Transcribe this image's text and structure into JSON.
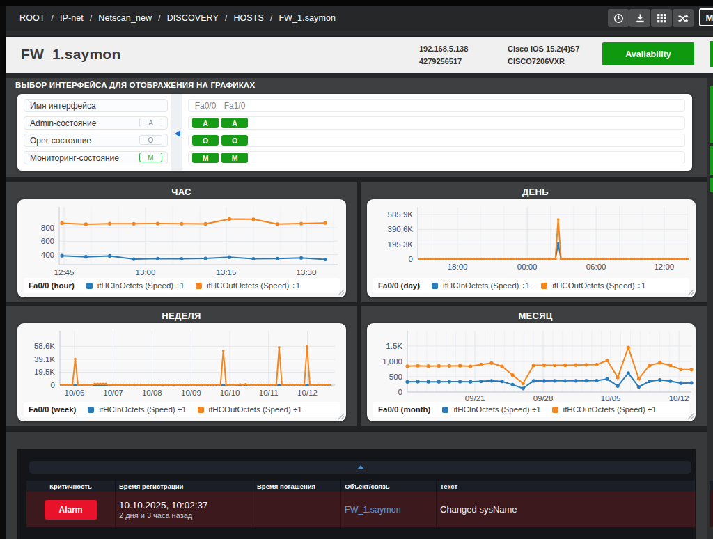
{
  "navbar": {
    "breadcrumb": [
      "ROOT",
      "IP-net",
      "Netscan_new",
      "DISCOVERY",
      "HOSTS",
      "FW_1.saymon"
    ],
    "separator": "/",
    "buttons": [
      {
        "icon": "clock-icon"
      },
      {
        "icon": "download-icon"
      },
      {
        "icon": "grid-icon"
      },
      {
        "icon": "shuffle-icon"
      }
    ],
    "mode_button_label": "M"
  },
  "header": {
    "title": "FW_1.saymon",
    "ip": "192.168.5.138",
    "object_id": "4279256517",
    "os_version": "Cisco IOS 15.2(4)S7",
    "model": "CISCO7206VXR",
    "availability_label": "Availability",
    "availability_color": "#0f990f"
  },
  "interface_panel": {
    "title": "ВЫБОР ИНТЕРФЕЙСА ДЛЯ ОТОБРАЖЕНИЯ НА ГРАФИКАХ",
    "rows": [
      {
        "label": "Имя интерфейса",
        "badge": ""
      },
      {
        "label": "Admin-состояние",
        "badge": "A",
        "badge_style": "gray"
      },
      {
        "label": "Oper-состояние",
        "badge": "O",
        "badge_style": "gray"
      },
      {
        "label": "Мониторинг-состояние",
        "badge": "M",
        "badge_style": "green-outline"
      }
    ],
    "interfaces": [
      "Fa0/0",
      "Fa1/0"
    ],
    "status_rows": [
      [
        "A",
        "A"
      ],
      [
        "O",
        "O"
      ],
      [
        "M",
        "M"
      ]
    ],
    "badge_color": "#169c16"
  },
  "chart_data": [
    {
      "type": "line",
      "title": "ЧАС",
      "legend_label": "Fa0/0 (hour)",
      "x": {
        "fstart": 0.01,
        "fend": 0.955,
        "ticks": [
          {
            "f": 0.0175,
            "label": "12:45"
          },
          {
            "f": 0.31,
            "label": "13:00"
          },
          {
            "f": 0.6,
            "label": "13:15"
          },
          {
            "f": 0.8875,
            "label": "13:30"
          }
        ],
        "minor": [
          0.115,
          0.2125,
          0.4075,
          0.505,
          0.6975,
          0.795,
          0.985
        ]
      },
      "y": {
        "bottom_value": 251,
        "top_value": 1110,
        "ticks": [
          {
            "v": 400,
            "label": "400"
          },
          {
            "v": 600,
            "label": "600"
          },
          {
            "v": 800,
            "label": "800"
          }
        ]
      },
      "series": [
        {
          "name": "ifHCInOctets (Speed) ÷1",
          "color": "#2c7bb9",
          "values": [
            383,
            368,
            381,
            333,
            341,
            339,
            343,
            363,
            339,
            341,
            351,
            329
          ]
        },
        {
          "name": "ifHCOutOctets (Speed) ÷1",
          "color": "#f5861f",
          "values": [
            868,
            852,
            860,
            858,
            861,
            859,
            857,
            930,
            926,
            853,
            861,
            870
          ]
        }
      ],
      "layout": {
        "plot_l": 60,
        "plot_r": 460,
        "plot_b": 94,
        "point_r": 2.6
      }
    },
    {
      "type": "line",
      "title": "ДЕНЬ",
      "legend_label": "Fa0/0 (day)",
      "x": {
        "fstart": 0.008,
        "fend": 1.0,
        "ticks": [
          {
            "f": 0.147,
            "label": "18:00"
          },
          {
            "f": 0.405,
            "label": "00:00"
          },
          {
            "f": 0.66,
            "label": "06:00"
          },
          {
            "f": 0.912,
            "label": "12:00"
          }
        ],
        "minor": [
          0.061,
          0.233,
          0.319,
          0.491,
          0.577,
          0.746,
          0.832,
          0.998
        ]
      },
      "y": {
        "bottom_value": 0,
        "top_value": 687000,
        "ticks": [
          {
            "v": 0,
            "label": "0"
          },
          {
            "v": 195300,
            "label": "195.3K"
          },
          {
            "v": 390600,
            "label": "390.6K"
          },
          {
            "v": 585900,
            "label": "585.9K"
          }
        ]
      },
      "series": [
        {
          "name": "ifHCInOctets (Speed) ÷1",
          "color": "#2c7bb9",
          "values": [
            300,
            300,
            300,
            300,
            300,
            300,
            300,
            300,
            300,
            300,
            300,
            300,
            300,
            300,
            300,
            300,
            300,
            300,
            300,
            300,
            300,
            300,
            300,
            300,
            300,
            300,
            300,
            300,
            300,
            300,
            300,
            300,
            300,
            300,
            300,
            300,
            300,
            300,
            300,
            300,
            300,
            300,
            300,
            300,
            300,
            300,
            300,
            300,
            300,
            210000,
            300,
            300,
            300,
            300,
            300,
            300,
            300,
            300,
            300,
            300,
            300,
            300,
            300,
            300,
            300,
            300,
            300,
            300,
            300,
            300,
            300,
            300,
            300,
            300,
            300,
            300,
            300,
            300,
            300,
            300,
            300,
            300,
            300,
            300,
            300,
            300,
            300,
            300,
            300,
            300,
            300,
            300,
            300,
            300,
            300,
            300
          ]
        },
        {
          "name": "ifHCOutOctets (Speed) ÷1",
          "color": "#f5861f",
          "values": [
            800,
            800,
            800,
            800,
            800,
            800,
            800,
            800,
            800,
            800,
            800,
            800,
            800,
            800,
            800,
            800,
            800,
            800,
            800,
            800,
            800,
            800,
            800,
            800,
            800,
            800,
            800,
            800,
            800,
            800,
            800,
            800,
            800,
            800,
            800,
            800,
            800,
            800,
            800,
            800,
            800,
            800,
            800,
            800,
            800,
            800,
            800,
            800,
            800,
            522000,
            800,
            800,
            800,
            800,
            800,
            800,
            800,
            800,
            800,
            800,
            800,
            800,
            800,
            800,
            800,
            800,
            800,
            800,
            800,
            800,
            800,
            800,
            800,
            800,
            800,
            800,
            800,
            800,
            800,
            800,
            800,
            800,
            800,
            800,
            800,
            800,
            800,
            800,
            800,
            800,
            800,
            800,
            800,
            800,
            800,
            800
          ]
        }
      ],
      "layout": {
        "plot_l": 73,
        "plot_r": 461,
        "plot_b": 86,
        "point_r": 1.8
      }
    },
    {
      "type": "line",
      "title": "НЕДЕЛЯ",
      "legend_label": "Fa0/0 (week)",
      "x": {
        "fstart": 0.005,
        "fend": 0.98,
        "ticks": [
          {
            "f": 0.053,
            "label": "10/06"
          },
          {
            "f": 0.194,
            "label": "10/07"
          },
          {
            "f": 0.335,
            "label": "10/08"
          },
          {
            "f": 0.477,
            "label": "10/09"
          },
          {
            "f": 0.618,
            "label": "10/10"
          },
          {
            "f": 0.759,
            "label": "10/11"
          },
          {
            "f": 0.9,
            "label": "10/12"
          }
        ],
        "minor": []
      },
      "y": {
        "bottom_value": 0,
        "top_value": 82200,
        "ticks": [
          {
            "v": 0,
            "label": "0"
          },
          {
            "v": 19500,
            "label": "19.5K"
          },
          {
            "v": 39100,
            "label": "39.1K"
          },
          {
            "v": 58600,
            "label": "58.6K"
          }
        ]
      },
      "series": [
        {
          "name": "ifHCInOctets (Speed) ÷1",
          "color": "#2c7bb9",
          "values": [
            120,
            120,
            120,
            120,
            120,
            120,
            120,
            120,
            120,
            120,
            120,
            120,
            120,
            120,
            120,
            120,
            120,
            120,
            120,
            120,
            120,
            120,
            120,
            120,
            120,
            120,
            120,
            120,
            120,
            120,
            120,
            120,
            120,
            120,
            120,
            120,
            120,
            120,
            120,
            120,
            120,
            120,
            120,
            120,
            120,
            120,
            120,
            120,
            120,
            120,
            120,
            120,
            120,
            120,
            120,
            120,
            120,
            120,
            120,
            120,
            120,
            120,
            120,
            120,
            120,
            120,
            120,
            120,
            120,
            120,
            120,
            120,
            120,
            120,
            120,
            120,
            120,
            120,
            120,
            120,
            120,
            120,
            120,
            120,
            120,
            120,
            120,
            120,
            120,
            120,
            120,
            120,
            120,
            120,
            120,
            120,
            120
          ]
        },
        {
          "name": "ifHCOutOctets (Speed) ÷1",
          "color": "#f5861f",
          "values": [
            250,
            250,
            250,
            250,
            250,
            39500,
            250,
            250,
            250,
            250,
            250,
            250,
            1700,
            1700,
            1700,
            1700,
            1700,
            250,
            250,
            250,
            250,
            250,
            250,
            250,
            250,
            250,
            250,
            250,
            250,
            250,
            250,
            250,
            250,
            250,
            250,
            250,
            250,
            250,
            250,
            250,
            250,
            250,
            250,
            250,
            250,
            250,
            250,
            250,
            250,
            250,
            250,
            250,
            250,
            250,
            250,
            250,
            250,
            250,
            52000,
            250,
            250,
            250,
            250,
            250,
            1100,
            250,
            1300,
            250,
            250,
            250,
            250,
            250,
            250,
            250,
            250,
            250,
            250,
            250,
            57000,
            250,
            250,
            250,
            250,
            250,
            250,
            250,
            250,
            250,
            58600,
            250,
            250,
            250,
            250,
            250,
            250,
            250,
            250
          ]
        }
      ],
      "layout": {
        "plot_l": 61,
        "plot_r": 456,
        "plot_b": 89,
        "point_r": 1.8
      }
    },
    {
      "type": "line",
      "title": "МЕСЯЦ",
      "legend_label": "Fa0/0 (month)",
      "x": {
        "fstart": 0.0,
        "fend": 1.0,
        "ticks": [
          {
            "f": 0.238,
            "label": "09/21"
          },
          {
            "f": 0.478,
            "label": "09/28"
          },
          {
            "f": 0.716,
            "label": "10/05"
          },
          {
            "f": 0.956,
            "label": "10/12"
          }
        ],
        "minor": [
          0.0341,
          0.0683,
          0.1024,
          0.1366,
          0.1708,
          0.2049,
          0.2732,
          0.3074,
          0.3415,
          0.3756,
          0.4098,
          0.444,
          0.5122,
          0.5464,
          0.5806,
          0.6147,
          0.6489,
          0.683,
          0.7513,
          0.7854,
          0.8196,
          0.8538,
          0.8879,
          0.9221
        ]
      },
      "y": {
        "bottom_value": 0,
        "top_value": 2000,
        "ticks": [
          {
            "v": 0,
            "label": "0"
          },
          {
            "v": 500,
            "label": "500"
          },
          {
            "v": 1000,
            "label": "1,000"
          },
          {
            "v": 1500,
            "label": "1.5K"
          }
        ]
      },
      "series": [
        {
          "name": "ifHCInOctets (Speed) ÷1",
          "color": "#2c7bb9",
          "values": [
            335,
            338,
            336,
            337,
            338,
            340,
            336,
            350,
            368,
            348,
            240,
            118,
            365,
            367,
            368,
            368,
            369,
            370,
            372,
            428,
            198,
            618,
            168,
            352,
            398,
            360,
            292,
            300
          ]
        },
        {
          "name": "ifHCOutOctets (Speed) ÷1",
          "color": "#f5861f",
          "values": [
            845,
            860,
            848,
            855,
            855,
            858,
            838,
            900,
            948,
            840,
            555,
            285,
            872,
            874,
            876,
            878,
            882,
            890,
            895,
            1035,
            480,
            1455,
            435,
            865,
            960,
            870,
            740,
            735
          ]
        }
      ],
      "layout": {
        "plot_l": 58,
        "plot_r": 466,
        "plot_b": 99,
        "point_r": 2.6
      }
    }
  ],
  "alarms": {
    "columns": [
      "Критичность",
      "Время регистрации",
      "Время погашения",
      "Объект/связь",
      "Текст"
    ],
    "rows": [
      {
        "severity": "Alarm",
        "severity_color": "#e8132a",
        "registered": "10.10.2025, 10:02:37",
        "registered_ago": "2 дня и 3 часа назад",
        "cleared": "",
        "object": "FW_1.saymon",
        "text": "Changed sysName"
      }
    ]
  }
}
